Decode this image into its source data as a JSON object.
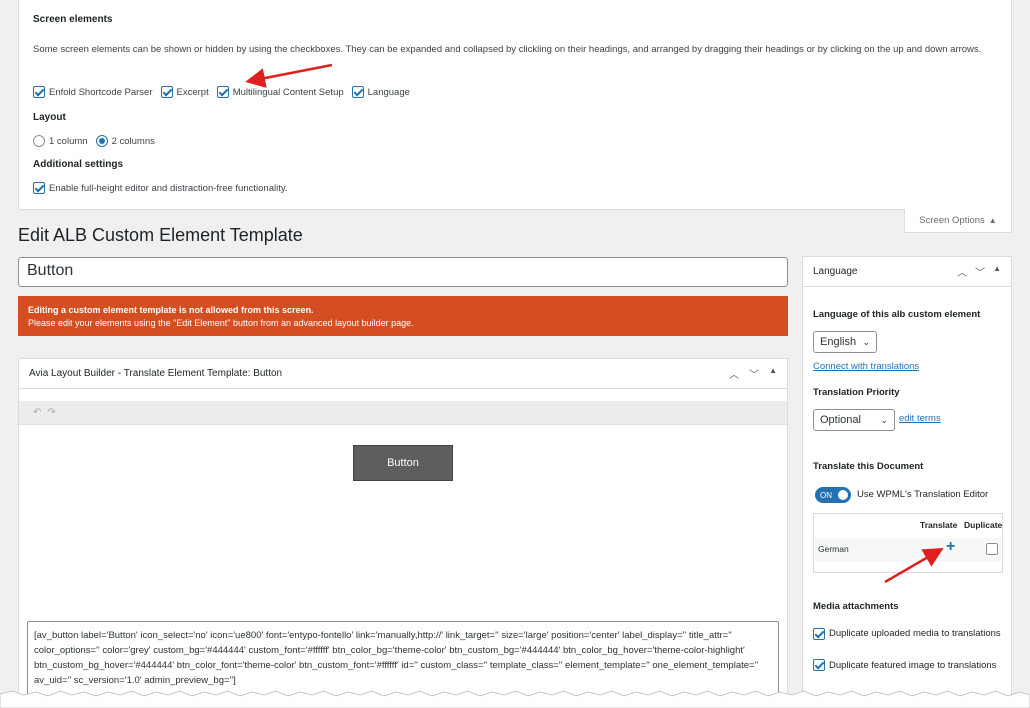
{
  "screen_options": {
    "heading": "Screen elements",
    "description": "Some screen elements can be shown or hidden by using the checkboxes. They can be expanded and collapsed by clickling on their headings, and arranged by dragging their headings or by clicking on the up and down arrows.",
    "checkboxes": [
      {
        "label": "Enfold Shortcode Parser",
        "checked": true
      },
      {
        "label": "Excerpt",
        "checked": true
      },
      {
        "label": "Multilingual Content Setup",
        "checked": true
      },
      {
        "label": "Language",
        "checked": true
      }
    ],
    "layout_heading": "Layout",
    "layout_options": [
      {
        "label": "1 column",
        "selected": false
      },
      {
        "label": "2 columns",
        "selected": true
      }
    ],
    "additional_heading": "Additional settings",
    "additional_checkbox": "Enable full-height editor and distraction-free functionality.",
    "tab_label": "Screen Options",
    "tab_icon": "triangle-up-icon"
  },
  "page": {
    "title": "Edit ALB Custom Element Template",
    "post_title_value": "Button"
  },
  "notice": {
    "line1": "Editing a custom element template is not allowed from this screen.",
    "line2": "Please edit your elements using the \"Edit Element\" button from an advanced layout builder page.",
    "color": "#d54e21"
  },
  "alb": {
    "title": "Avia Layout Builder - Translate Element Template: Button",
    "preview_button_label": "Button",
    "shortcode": "[av_button label='Button' icon_select='no' icon='ue800' font='entypo-fontello' link='manually,http://' link_target='' size='large' position='center' label_display='' title_attr='' color_options='' color='grey' custom_bg='#444444' custom_font='#ffffff' btn_color_bg='theme-color' btn_custom_bg='#444444' btn_color_bg_hover='theme-color-highlight' btn_custom_bg_hover='#444444' btn_color_font='theme-color' btn_custom_font='#ffffff' id='' custom_class='' template_class='' element_template='' one_element_template='' av_uid='' sc_version='1.0' admin_preview_bg='']"
  },
  "language": {
    "box_title": "Language",
    "lang_label": "Language of this alb custom element",
    "lang_value": "English",
    "connect_link": "Connect with translations",
    "priority_label": "Translation Priority",
    "priority_value": "Optional",
    "edit_terms": "edit terms",
    "translate_doc_label": "Translate this Document",
    "toggle_label": "ON",
    "toggle_text": "Use WPML's Translation Editor",
    "col_translate": "Translate",
    "col_duplicate": "Duplicate",
    "row_language": "German",
    "media_label": "Media attachments",
    "media_option1": "Duplicate uploaded media to translations",
    "media_option2": "Duplicate featured image to translations",
    "accent": "#2271b1"
  },
  "annotations": {
    "arrow_color": "#e02020"
  }
}
